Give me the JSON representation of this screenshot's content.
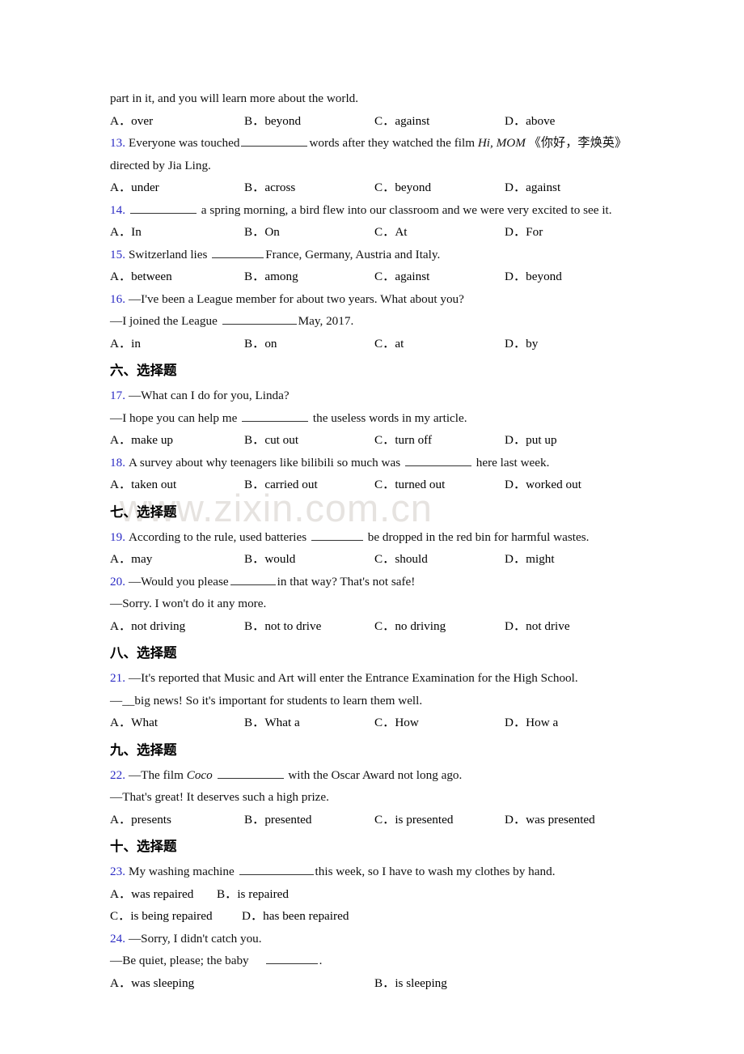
{
  "document": {
    "watermark": "www.zixin.com.cn",
    "accent_blue": "#2b2bc4",
    "page_background": "#ffffff"
  },
  "body": {
    "carryover_line": "part in it, and you will learn more about the world.",
    "q12_options": {
      "a": "over",
      "b": "beyond",
      "c": "against",
      "d": "above"
    },
    "q13": {
      "num": "13.",
      "text_before": "Everyone was touched",
      "text_after": "words after they watched the film",
      "film_title": "Hi, MOM",
      "chinese_title": "《你好，李焕英》",
      "line2": "directed by Jia Ling.",
      "options": {
        "a": "under",
        "b": "across",
        "c": "beyond",
        "d": "against"
      }
    },
    "q14": {
      "num": "14.",
      "text_after": "a spring morning, a bird flew into our classroom and we were very excited to see it.",
      "options": {
        "a": "In",
        "b": "On",
        "c": "At",
        "d": "For"
      }
    },
    "q15": {
      "num": "15.",
      "text_before": "Switzerland lies",
      "text_after": "France, Germany, Austria and Italy.",
      "options": {
        "a": "between",
        "b": "among",
        "c": "against",
        "d": "beyond"
      }
    },
    "q16": {
      "num": "16.",
      "line1": "—I've been a League member for about two years. What about you?",
      "line2_before": "—I joined the League",
      "line2_after": "May, 2017.",
      "options": {
        "a": "in",
        "b": "on",
        "c": "at",
        "d": "by"
      }
    },
    "section6": {
      "heading": "六、选择题"
    },
    "q17": {
      "num": "17.",
      "line1": "—What can I do for you, Linda?",
      "line2_before": "—I hope you can help me",
      "line2_after": "the useless words in my article.",
      "options": {
        "a": "make up",
        "b": "cut out",
        "c": "turn off",
        "d": "put up"
      }
    },
    "q18": {
      "num": "18.",
      "text_before": "A survey about why teenagers like bilibili so much was",
      "text_after": "here last week.",
      "options": {
        "a": "taken out",
        "b": "carried out",
        "c": "turned out",
        "d": "worked out"
      }
    },
    "section7": {
      "heading": "七、选择题"
    },
    "q19": {
      "num": "19.",
      "text_before": "According to the rule, used batteries",
      "text_after": "be dropped in the red bin for harmful wastes.",
      "options": {
        "a": "may",
        "b": "would",
        "c": "should",
        "d": "might"
      }
    },
    "q20": {
      "num": "20.",
      "line1_before": "—Would you please",
      "line1_after": "in that way? That's not safe!",
      "line2": "—Sorry. I won't do it any more.",
      "options": {
        "a": "not driving",
        "b": "not to drive",
        "c": "no driving",
        "d": "not drive"
      }
    },
    "section8": {
      "heading": "八、选择题"
    },
    "q21": {
      "num": "21.",
      "line1": "—It's reported that Music and Art will enter the Entrance Examination for the High School.",
      "line2": "—__big news! So it's important for students to learn them well.",
      "options": {
        "a": "What",
        "b": "What a",
        "c": "How",
        "d": "How a"
      }
    },
    "section9": {
      "heading": "九、选择题"
    },
    "q22": {
      "num": "22.",
      "line1_before": "—The film",
      "film_title": "Coco",
      "line1_after": "with the Oscar Award not long ago.",
      "line2": "—That's great! It deserves such a high prize.",
      "options": {
        "a": "presents",
        "b": "presented",
        "c": "is presented",
        "d": "was presented"
      }
    },
    "section10": {
      "heading": "十、选择题"
    },
    "q23": {
      "num": "23.",
      "text_before": "My washing machine",
      "text_after": "this week, so I have to wash my clothes by hand.",
      "options": {
        "a": "was repaired",
        "b": "is repaired",
        "c": "is being repaired",
        "d": "has been repaired"
      }
    },
    "q24": {
      "num": "24.",
      "line1": "—Sorry, I didn't catch you.",
      "line2_before": "—Be quiet, please; the baby",
      "line2_after": ".",
      "options": {
        "a": "was sleeping",
        "b": "is sleeping"
      }
    }
  },
  "labels": {
    "a": "A．",
    "b": "B．",
    "c": "C．",
    "d": "D．"
  }
}
